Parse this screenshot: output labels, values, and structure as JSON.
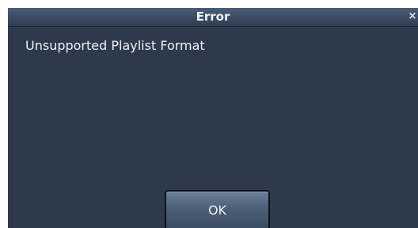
{
  "dialog": {
    "title": "Error",
    "close_glyph": "×",
    "close_icon": "close-icon",
    "message": "Unsupported Playlist Format",
    "ok_label": "OK"
  },
  "colors": {
    "background": "#2d3a4d",
    "titlebar": "#3a4b62",
    "text": "#f0f0f0",
    "button": "#4d5f78"
  }
}
